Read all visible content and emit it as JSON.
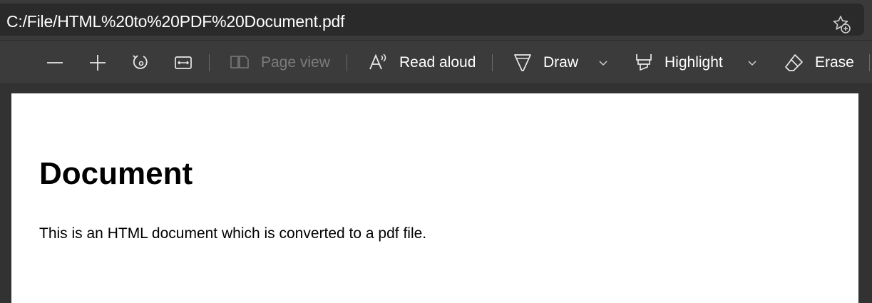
{
  "address_bar": {
    "url": "C:/File/HTML%20to%20PDF%20Document.pdf",
    "favorite_icon": "star-add-icon"
  },
  "toolbar": {
    "zoom_out_icon": "minus-icon",
    "zoom_in_icon": "plus-icon",
    "rotate_icon": "rotate-icon",
    "fit_icon": "fit-width-icon",
    "page_view_label": "Page view",
    "read_aloud_label": "Read aloud",
    "draw_label": "Draw",
    "highlight_label": "Highlight",
    "erase_label": "Erase"
  },
  "document": {
    "title": "Document",
    "body": "This is an HTML document which is converted to a pdf file."
  },
  "colors": {
    "toolbar_bg": "#3b3b3b",
    "address_bg": "#2a2a2a",
    "page_bg": "#ffffff",
    "disabled_text": "#7c7c7c"
  }
}
